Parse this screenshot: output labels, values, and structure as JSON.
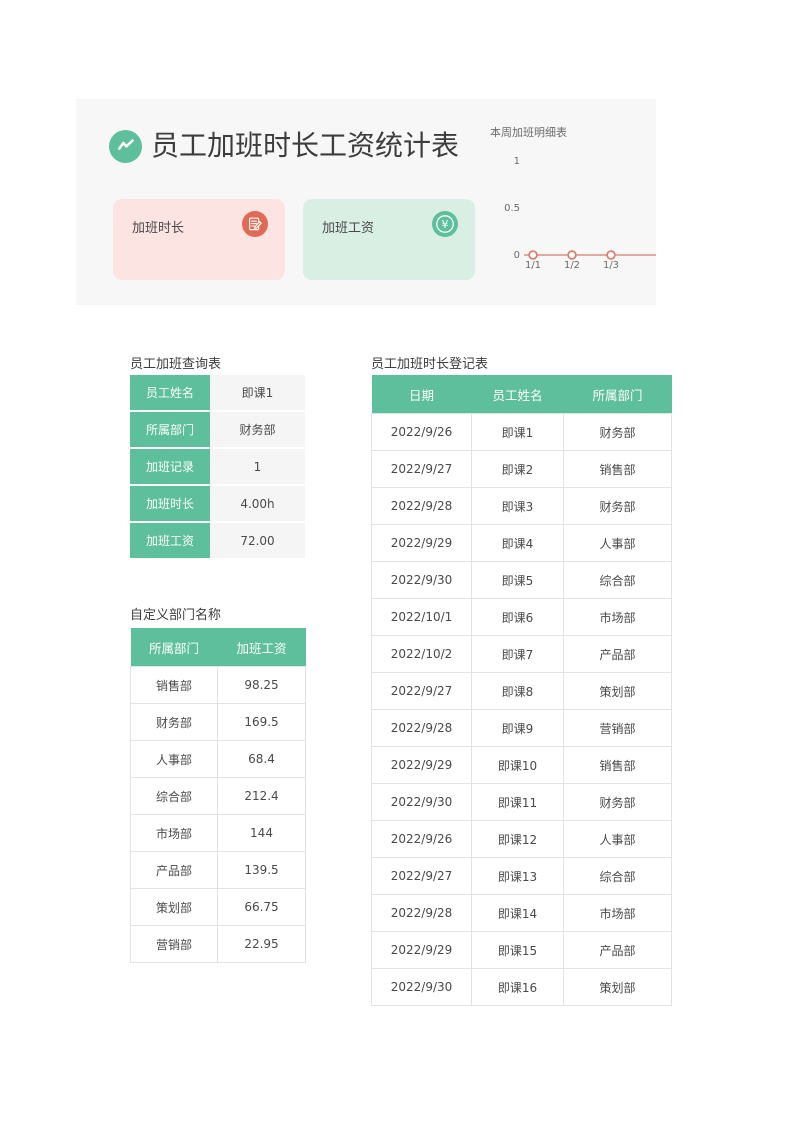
{
  "header": {
    "title": "员工加班时长工资统计表",
    "logo_icon": "chart-line-icon"
  },
  "kpi_cards": [
    {
      "label": "加班时长",
      "icon": "document-edit-icon",
      "color": "#e06a56",
      "bg": "#fbe4e1"
    },
    {
      "label": "加班工资",
      "icon": "yen-currency-icon",
      "glyph": "¥",
      "color": "#5dbf9b",
      "bg": "#d9efe4"
    }
  ],
  "chart_data": {
    "type": "line",
    "title": "本周加班明细表",
    "categories": [
      "1/1",
      "1/2",
      "1/3"
    ],
    "values": [
      0,
      0,
      0
    ],
    "series": [
      {
        "name": "本周加班明细表",
        "values": [
          0,
          0,
          0
        ]
      }
    ],
    "ylim": [
      0,
      1
    ],
    "yticks": [
      "0",
      "0.5",
      "1"
    ],
    "xlabel": "",
    "ylabel": "",
    "grid": false,
    "legend": "none",
    "line_color": "#e08878",
    "marker_fill": "#ffffff"
  },
  "query_panel": {
    "heading": "员工加班查询表",
    "rows": [
      {
        "key": "员工姓名",
        "value": "即课1"
      },
      {
        "key": "所属部门",
        "value": "财务部"
      },
      {
        "key": "加班记录",
        "value": "1"
      },
      {
        "key": "加班时长",
        "value": "4.00h"
      },
      {
        "key": "加班工资",
        "value": "72.00"
      }
    ]
  },
  "dept_panel": {
    "heading": "自定义部门名称",
    "columns": [
      "所属部门",
      "加班工资"
    ],
    "rows": [
      [
        "销售部",
        "98.25"
      ],
      [
        "财务部",
        "169.5"
      ],
      [
        "人事部",
        "68.4"
      ],
      [
        "综合部",
        "212.4"
      ],
      [
        "市场部",
        "144"
      ],
      [
        "产品部",
        "139.5"
      ],
      [
        "策划部",
        "66.75"
      ],
      [
        "营销部",
        "22.95"
      ]
    ]
  },
  "log_panel": {
    "heading": "员工加班时长登记表",
    "columns": [
      "日期",
      "员工姓名",
      "所属部门"
    ],
    "rows": [
      [
        "2022/9/26",
        "即课1",
        "财务部"
      ],
      [
        "2022/9/27",
        "即课2",
        "销售部"
      ],
      [
        "2022/9/28",
        "即课3",
        "财务部"
      ],
      [
        "2022/9/29",
        "即课4",
        "人事部"
      ],
      [
        "2022/9/30",
        "即课5",
        "综合部"
      ],
      [
        "2022/10/1",
        "即课6",
        "市场部"
      ],
      [
        "2022/10/2",
        "即课7",
        "产品部"
      ],
      [
        "2022/9/27",
        "即课8",
        "策划部"
      ],
      [
        "2022/9/28",
        "即课9",
        "营销部"
      ],
      [
        "2022/9/29",
        "即课10",
        "销售部"
      ],
      [
        "2022/9/30",
        "即课11",
        "财务部"
      ],
      [
        "2022/9/26",
        "即课12",
        "人事部"
      ],
      [
        "2022/9/27",
        "即课13",
        "综合部"
      ],
      [
        "2022/9/28",
        "即课14",
        "市场部"
      ],
      [
        "2022/9/29",
        "即课15",
        "产品部"
      ],
      [
        "2022/9/30",
        "即课16",
        "策划部"
      ]
    ]
  },
  "theme": {
    "accent_green": "#5dbf9b",
    "accent_red": "#e06a56",
    "panel_bg": "#f7f7f7",
    "card_bg": "#ffffff"
  }
}
